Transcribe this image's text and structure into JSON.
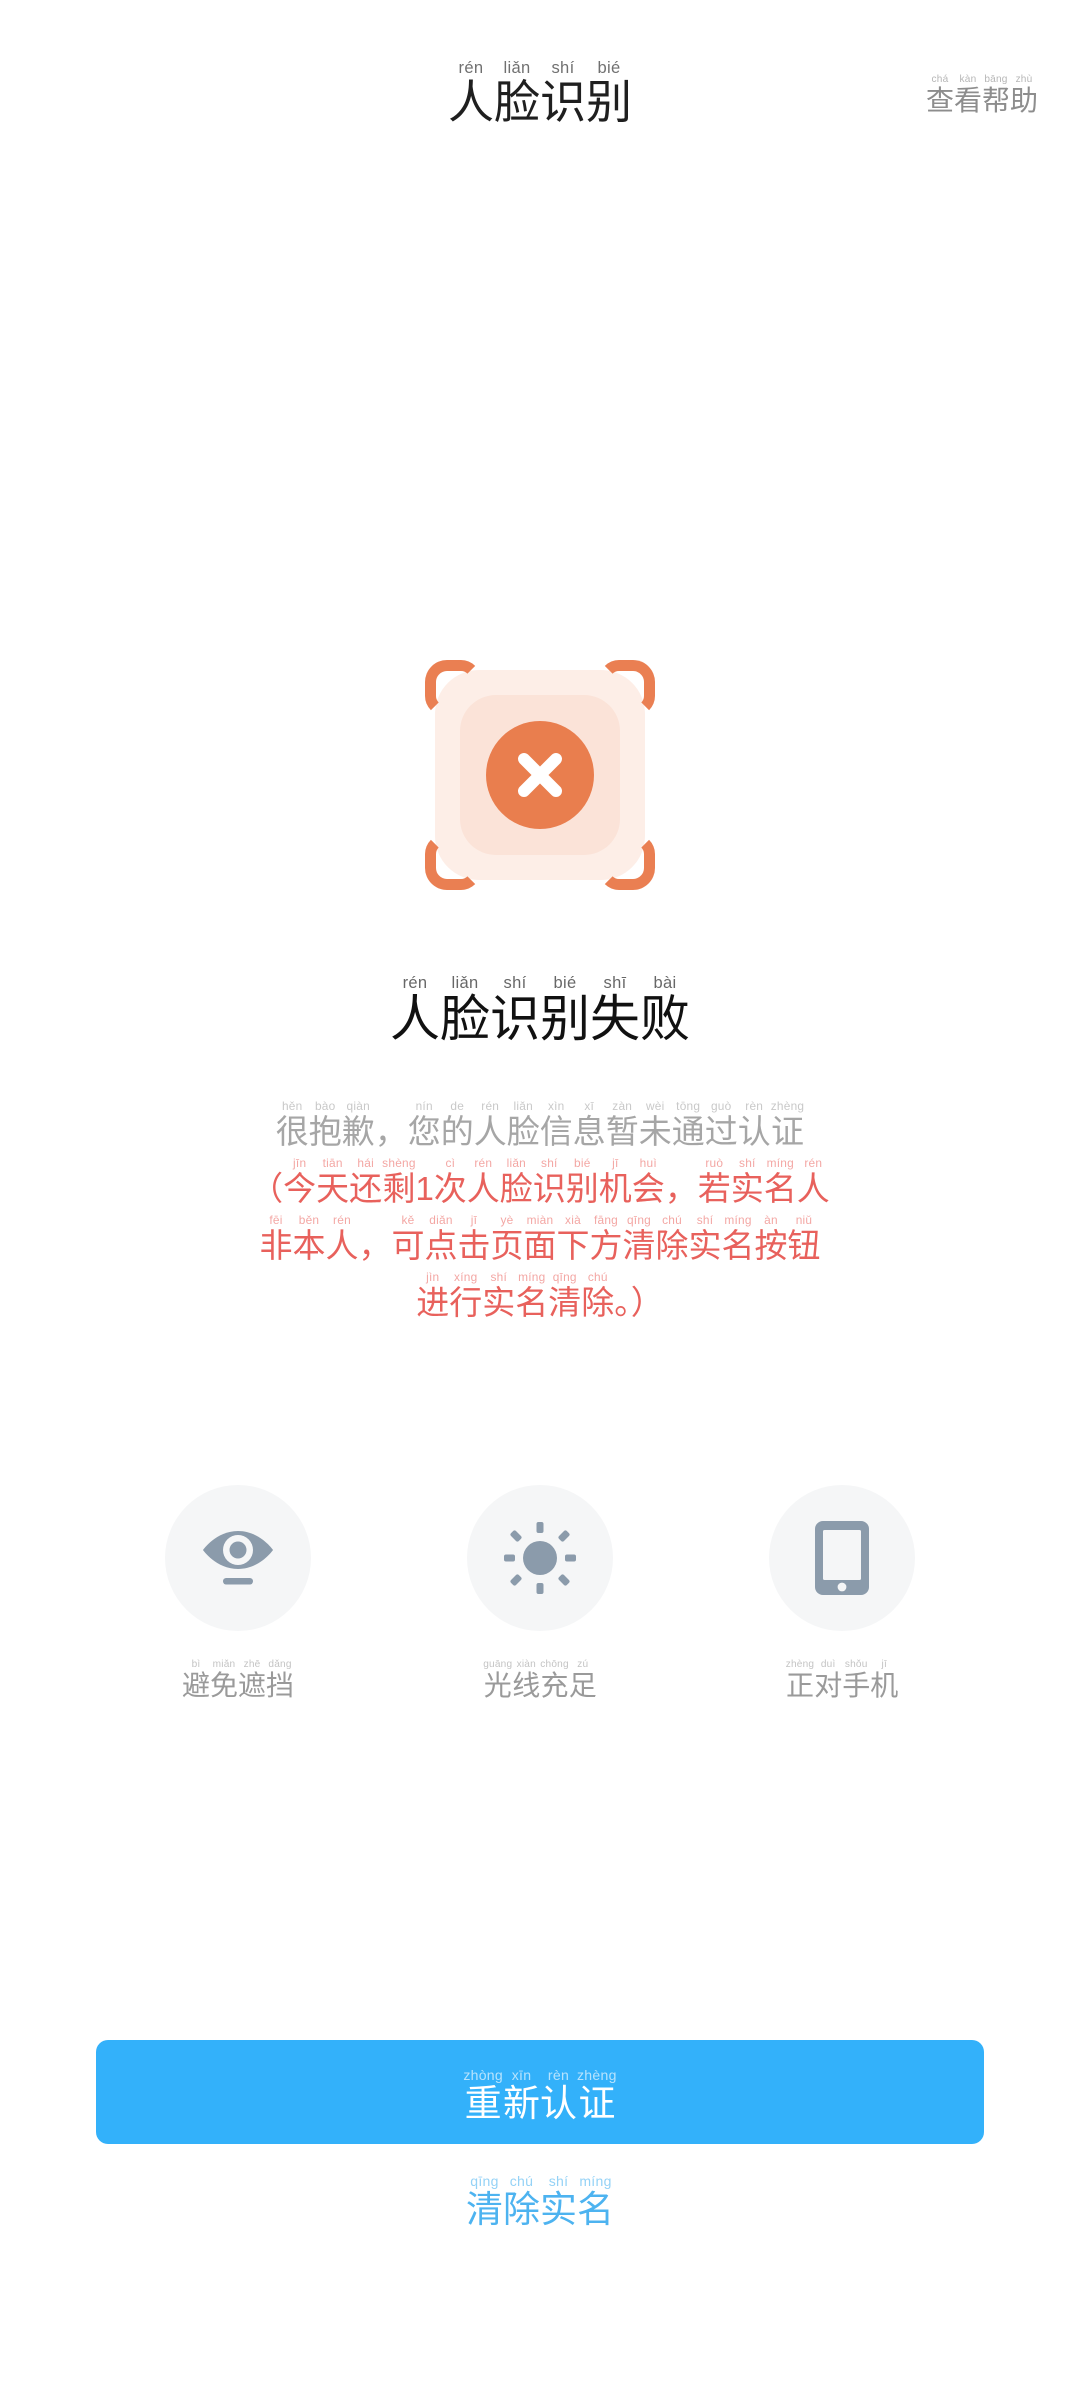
{
  "header": {
    "title": {
      "text": "人脸识别",
      "pinyin": [
        "rén",
        "liǎn",
        "shí",
        "bié"
      ]
    },
    "help": {
      "text": "查看帮助",
      "pinyin": [
        "chá",
        "kàn",
        "bāng",
        "zhù"
      ]
    }
  },
  "status": {
    "icon": "face-scan-failed-icon",
    "symbol": "×",
    "accent_color": "#e97e4e",
    "frame_color": "#ea7f52",
    "inner_color": "#fbe3d8",
    "backdrop_color": "#fdeee7"
  },
  "result": {
    "title": {
      "text": "人脸识别失败",
      "pinyin": [
        "rén",
        "liǎn",
        "shí",
        "bié",
        "shī",
        "bài"
      ]
    }
  },
  "description": {
    "lines": [
      {
        "color": "#a6a6a6",
        "chars": [
          "很",
          "抱",
          "歉",
          "，",
          "您",
          "的",
          "人",
          "脸",
          "信",
          "息",
          "暂",
          "未",
          "通",
          "过",
          "认",
          "证"
        ],
        "pinyin": [
          "hěn",
          "bào",
          "qiàn",
          "",
          "nín",
          "de",
          "rén",
          "liǎn",
          "xìn",
          "xī",
          "zàn",
          "wèi",
          "tōng",
          "guò",
          "rèn",
          "zhèng"
        ]
      },
      {
        "color": "#e8615c",
        "chars": [
          "（",
          "今",
          "天",
          "还",
          "剩",
          "1",
          "次",
          "人",
          "脸",
          "识",
          "别",
          "机",
          "会",
          "，",
          "若",
          "实",
          "名",
          "人"
        ],
        "pinyin": [
          "",
          "jīn",
          "tiān",
          "hái",
          "shèng",
          "",
          "cì",
          "rén",
          "liǎn",
          "shí",
          "bié",
          "jī",
          "huì",
          "",
          "ruò",
          "shí",
          "míng",
          "rén"
        ]
      },
      {
        "color": "#e8615c",
        "chars": [
          "非",
          "本",
          "人",
          "，",
          "可",
          "点",
          "击",
          "页",
          "面",
          "下",
          "方",
          "清",
          "除",
          "实",
          "名",
          "按",
          "钮"
        ],
        "pinyin": [
          "fēi",
          "běn",
          "rén",
          "",
          "kě",
          "diǎn",
          "jī",
          "yè",
          "miàn",
          "xià",
          "fāng",
          "qīng",
          "chú",
          "shí",
          "míng",
          "àn",
          "niǔ"
        ]
      },
      {
        "color": "#e8615c",
        "chars": [
          "进",
          "行",
          "实",
          "名",
          "清",
          "除",
          "。",
          "）"
        ],
        "pinyin": [
          "jìn",
          "xíng",
          "shí",
          "míng",
          "qīng",
          "chú",
          "",
          ""
        ]
      }
    ],
    "remaining_attempts": "1"
  },
  "tips": [
    {
      "icon": "eye-icon",
      "label": {
        "text": "避免遮挡",
        "pinyin": [
          "bì",
          "miǎn",
          "zhē",
          "dǎng"
        ]
      }
    },
    {
      "icon": "sun-icon",
      "label": {
        "text": "光线充足",
        "pinyin": [
          "guāng",
          "xiàn",
          "chōng",
          "zú"
        ]
      }
    },
    {
      "icon": "phone-icon",
      "label": {
        "text": "正对手机",
        "pinyin": [
          "zhèng",
          "duì",
          "shǒu",
          "jī"
        ]
      }
    }
  ],
  "actions": {
    "primary": {
      "text": "重新认证",
      "pinyin": [
        "zhòng",
        "xīn",
        "rèn",
        "zhèng"
      ],
      "color": "#33b1fa"
    },
    "secondary": {
      "text": "清除实名",
      "pinyin": [
        "qīng",
        "chú",
        "shí",
        "míng"
      ],
      "color": "#4db3f0"
    }
  }
}
